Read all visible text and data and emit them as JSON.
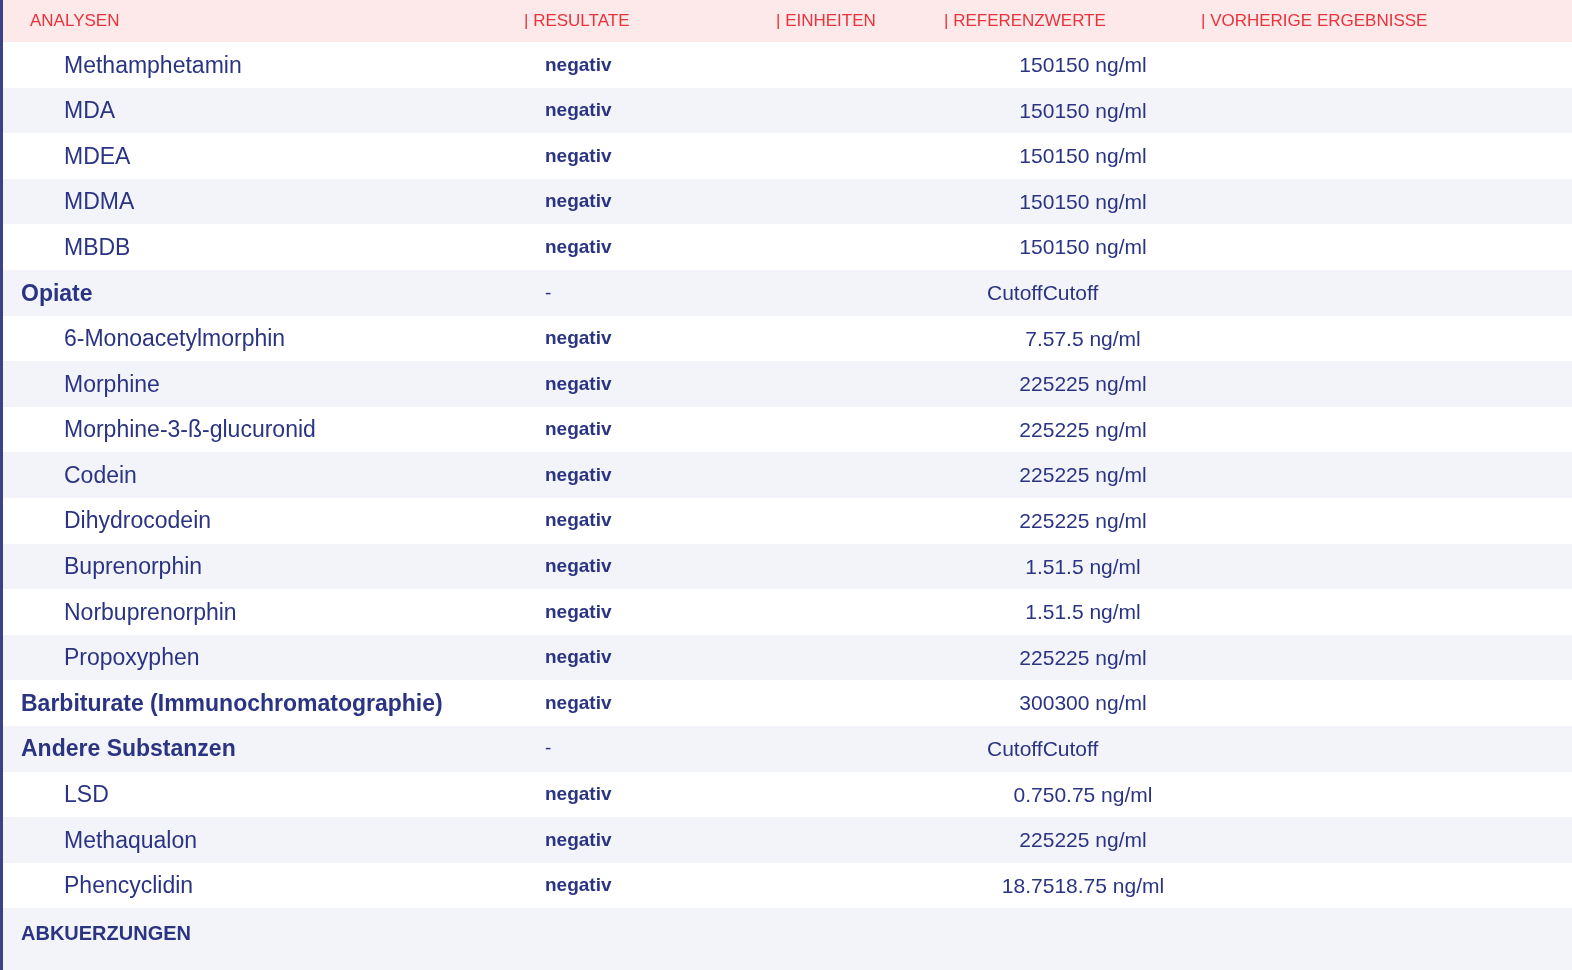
{
  "columns": [
    "ANALYSEN",
    "| RESULTATE",
    "| EINHEITEN",
    "| REFERENZWERTE",
    "| VORHERIGE ERGEBNISSE"
  ],
  "rows": [
    {
      "kind": "item",
      "name": "Methamphetamin",
      "result": "negativ",
      "reference": "150150 ng/ml"
    },
    {
      "kind": "item",
      "name": "MDA",
      "result": "negativ",
      "reference": "150150 ng/ml"
    },
    {
      "kind": "item",
      "name": "MDEA",
      "result": "negativ",
      "reference": "150150 ng/ml"
    },
    {
      "kind": "item",
      "name": "MDMA",
      "result": "negativ",
      "reference": "150150 ng/ml"
    },
    {
      "kind": "item",
      "name": "MBDB",
      "result": "negativ",
      "reference": "150150 ng/ml"
    },
    {
      "kind": "group",
      "name": "Opiate",
      "result": "-",
      "reference": "CutoffCutoff"
    },
    {
      "kind": "item",
      "name": "6-Monoacetylmorphin",
      "result": "negativ",
      "reference": "7.57.5 ng/ml"
    },
    {
      "kind": "item",
      "name": "Morphine",
      "result": "negativ",
      "reference": "225225 ng/ml"
    },
    {
      "kind": "item",
      "name": "Morphine-3-ß-glucuronid",
      "result": "negativ",
      "reference": "225225 ng/ml"
    },
    {
      "kind": "item",
      "name": "Codein",
      "result": "negativ",
      "reference": "225225 ng/ml"
    },
    {
      "kind": "item",
      "name": "Dihydrocodein",
      "result": "negativ",
      "reference": "225225 ng/ml"
    },
    {
      "kind": "item",
      "name": "Buprenorphin",
      "result": "negativ",
      "reference": "1.51.5 ng/ml"
    },
    {
      "kind": "item",
      "name": "Norbuprenorphin",
      "result": "negativ",
      "reference": "1.51.5 ng/ml"
    },
    {
      "kind": "item",
      "name": "Propoxyphen",
      "result": "negativ",
      "reference": "225225 ng/ml"
    },
    {
      "kind": "group",
      "name": "Barbiturate (Immunochromatographie)",
      "result": "negativ",
      "reference": "300300 ng/ml"
    },
    {
      "kind": "group",
      "name": "Andere Substanzen",
      "result": "-",
      "reference": "CutoffCutoff"
    },
    {
      "kind": "item",
      "name": "LSD",
      "result": "negativ",
      "reference": "0.750.75 ng/ml"
    },
    {
      "kind": "item",
      "name": "Methaqualon",
      "result": "negativ",
      "reference": "225225 ng/ml"
    },
    {
      "kind": "item",
      "name": "Phencyclidin",
      "result": "negativ",
      "reference": "18.7518.75 ng/ml"
    }
  ],
  "footer_heading": "ABKUERZUNGEN"
}
